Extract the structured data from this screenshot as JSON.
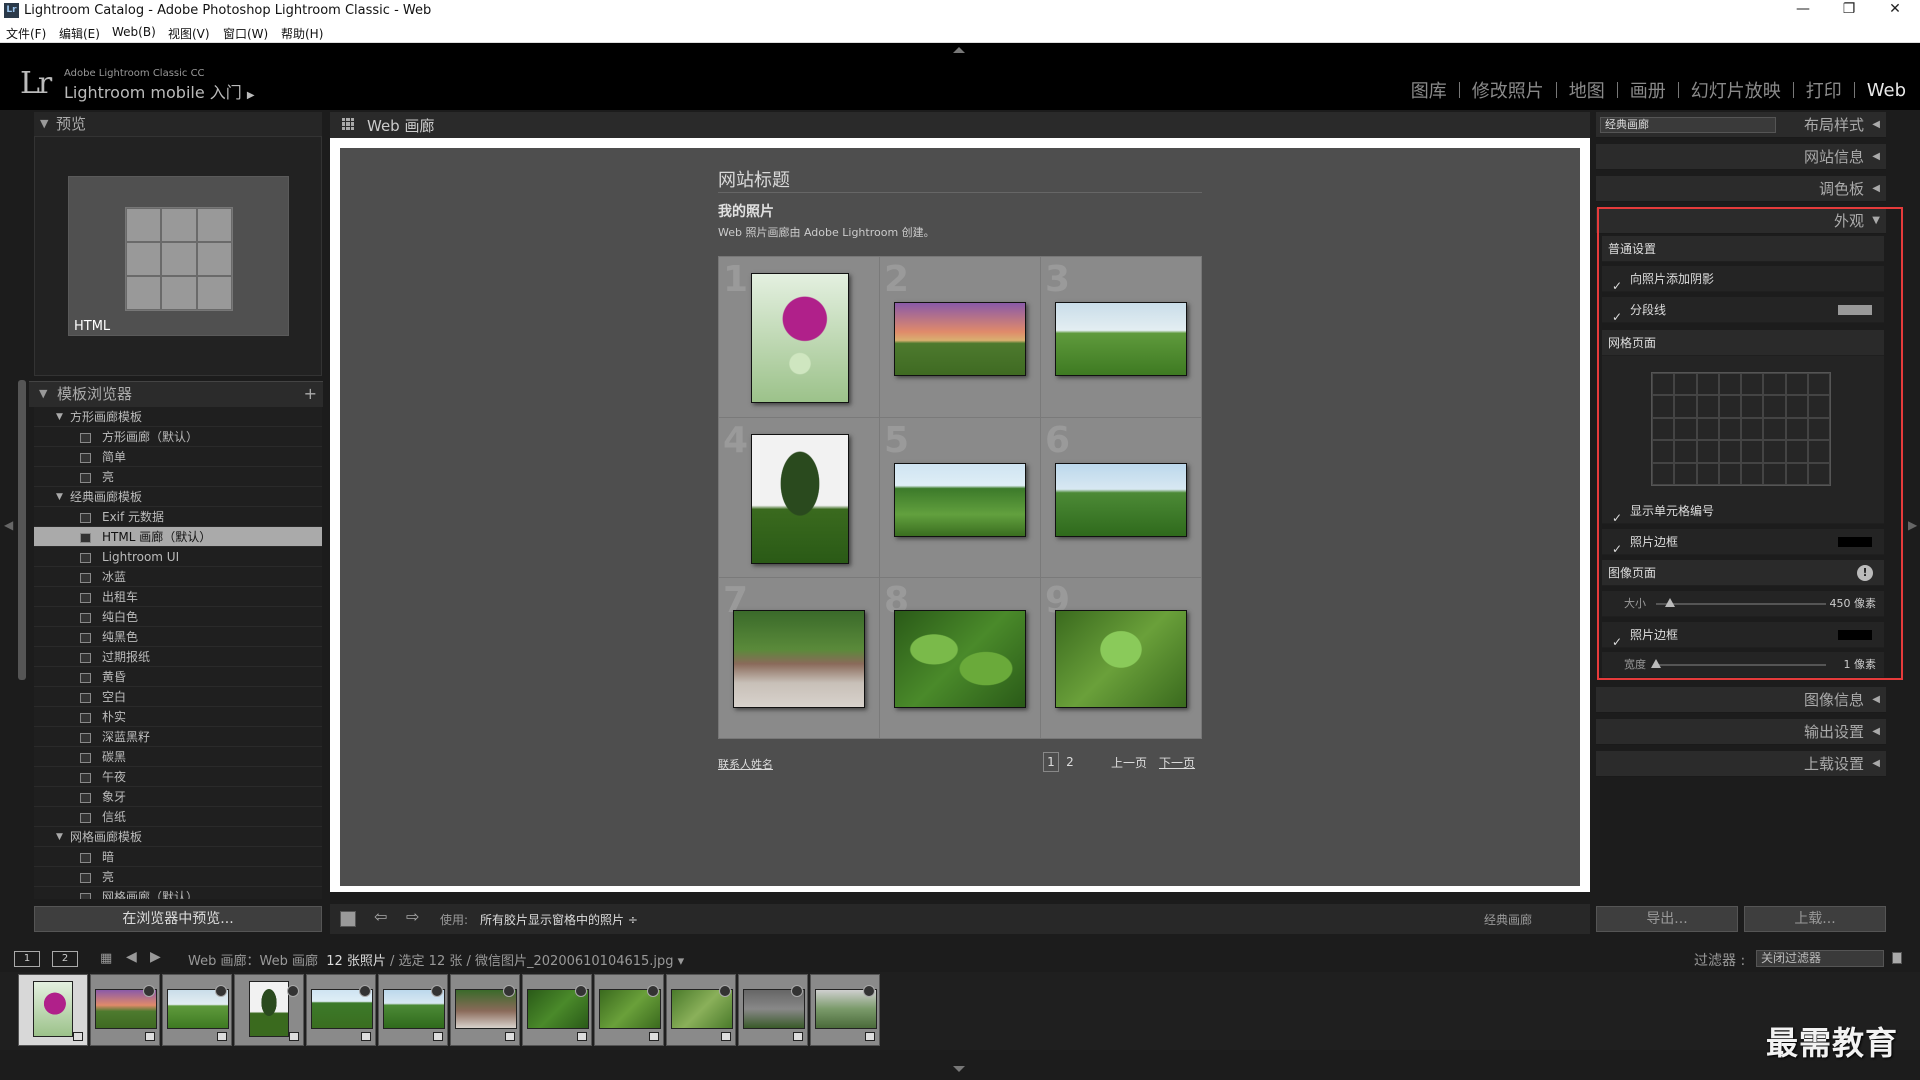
{
  "window": {
    "title": "Lightroom Catalog - Adobe Photoshop Lightroom Classic - Web",
    "app_icon": "Lr",
    "minimize": "—",
    "restore": "❐",
    "close": "✕"
  },
  "menu": [
    "文件(F)",
    "编辑(E)",
    "Web(B)",
    "视图(V)",
    "窗口(W)",
    "帮助(H)"
  ],
  "identity": {
    "logo": "Lr",
    "product": "Adobe Lightroom Classic CC",
    "mobile": "Lightroom mobile 入门",
    "mobile_arrow": "▶"
  },
  "modules": [
    "图库",
    "修改照片",
    "地图",
    "画册",
    "幻灯片放映",
    "打印",
    "Web"
  ],
  "active_module": "Web",
  "left": {
    "preview_header": "预览",
    "preview_label": "HTML",
    "template_header": "模板浏览器",
    "add": "+",
    "preview_button": "在浏览器中预览...",
    "templates": [
      {
        "type": "folder",
        "label": "方形画廊模板"
      },
      {
        "type": "item",
        "label": "方形画廊（默认）"
      },
      {
        "type": "item",
        "label": "简单"
      },
      {
        "type": "item",
        "label": "亮"
      },
      {
        "type": "folder",
        "label": "经典画廊模板"
      },
      {
        "type": "item",
        "label": "Exif 元数据"
      },
      {
        "type": "item",
        "label": "HTML 画廊（默认）",
        "selected": true
      },
      {
        "type": "item",
        "label": "Lightroom UI"
      },
      {
        "type": "item",
        "label": "冰蓝"
      },
      {
        "type": "item",
        "label": "出租车"
      },
      {
        "type": "item",
        "label": "纯白色"
      },
      {
        "type": "item",
        "label": "纯黑色"
      },
      {
        "type": "item",
        "label": "过期报纸"
      },
      {
        "type": "item",
        "label": "黄昏"
      },
      {
        "type": "item",
        "label": "空白"
      },
      {
        "type": "item",
        "label": "朴实"
      },
      {
        "type": "item",
        "label": "深蓝黑籽"
      },
      {
        "type": "item",
        "label": "碳黑"
      },
      {
        "type": "item",
        "label": "午夜"
      },
      {
        "type": "item",
        "label": "象牙"
      },
      {
        "type": "item",
        "label": "信纸"
      },
      {
        "type": "folder",
        "label": "网格画廊模板"
      },
      {
        "type": "item",
        "label": "暗"
      },
      {
        "type": "item",
        "label": "亮"
      },
      {
        "type": "item",
        "label": "网格画廊（默认）"
      }
    ]
  },
  "center": {
    "header": "Web 画廊",
    "site_title": "网站标题",
    "collection_title": "我的照片",
    "collection_desc": "Web 照片画廊由 Adobe Lightroom 创建。",
    "contact": "联系人姓名",
    "page_current": "1",
    "page_next": "2",
    "prev": "上一页",
    "next": "下一页",
    "cells": [
      "1",
      "2",
      "3",
      "4",
      "5",
      "6",
      "7",
      "8",
      "9"
    ]
  },
  "toolbar": {
    "use_label": "使用:",
    "use_value": "所有胶片显示窗格中的照片 ÷",
    "right_label": "经典画廊",
    "back_arrow": "⇦",
    "forward_arrow": "⇨"
  },
  "right": {
    "layout_select": "经典画廊",
    "layout_header": "布局样式",
    "site_info": "网站信息",
    "palette": "调色板",
    "appearance": "外观",
    "general": "普通设置",
    "add_shadow": "向照片添加阴影",
    "section_line": "分段线",
    "grid_pages": "网格页面",
    "show_cell_numbers": "显示单元格编号",
    "photo_borders": "照片边框",
    "image_pages": "图像页面",
    "size_label": "大小",
    "size_value": "450 像素",
    "size_fraction": 0.08,
    "image_border": "照片边框",
    "width_label": "宽度",
    "width_value": "1 像素",
    "width_fraction": 0.0,
    "image_info": "图像信息",
    "output": "输出设置",
    "upload_settings": "上载设置",
    "export_btn": "导出...",
    "upload_btn": "上载...",
    "check": "✓",
    "collapse_arrow": "◀",
    "expand_arrow": "▼",
    "warn": "!"
  },
  "filmbar": {
    "mon1": "1",
    "mon2": "2",
    "path": "Web 画廊：Web 画廊",
    "count": "12 张照片",
    "rest": " / 选定 12 张 / 微信图片_20200610104615.jpg ▾",
    "filter_label": "过滤器 :",
    "filter_value": "关闭过滤器"
  },
  "watermark": "最需教育",
  "colors": {
    "red_outline": "#e63b3b",
    "background": "#1c1c1c"
  }
}
